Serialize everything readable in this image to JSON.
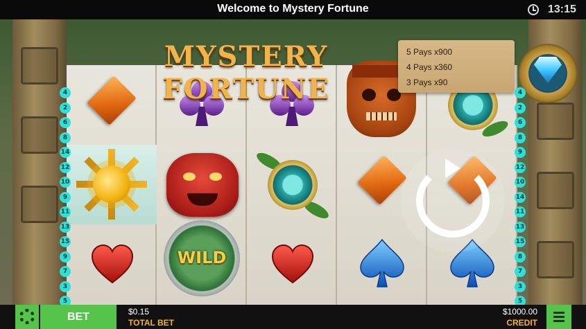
{
  "topbar": {
    "title": "Welcome to Mystery Fortune",
    "time": "13:15"
  },
  "logo": {
    "text": "MYSTERY FORTUNE"
  },
  "paytable": {
    "rows": [
      "5 Pays x900",
      "4 Pays x360",
      "3 Pays x90"
    ]
  },
  "paylines": {
    "left": [
      "4",
      "2",
      "6",
      "8",
      "14",
      "12",
      "10",
      "9",
      "11",
      "13",
      "15",
      "9",
      "7",
      "3",
      "5"
    ],
    "right": [
      "4",
      "2",
      "6",
      "8",
      "9",
      "12",
      "10",
      "14",
      "11",
      "13",
      "15",
      "8",
      "7",
      "3",
      "5"
    ]
  },
  "reels": [
    [
      "orange-diamond",
      "sun-symbol",
      "red-heart"
    ],
    [
      "purple-club",
      "red-mask",
      "wild"
    ],
    [
      "purple-club",
      "jade-medallion",
      "red-heart"
    ],
    [
      "orange-skull-mask",
      "orange-diamond",
      "blue-spade"
    ],
    [
      "jade-medallion",
      "orange-diamond",
      "blue-spade"
    ]
  ],
  "wild_label": "WILD",
  "colors": {
    "accent_green": "#56c34a",
    "label_gold": "#f5b51e",
    "payline_teal": "#2fe0d7"
  },
  "bottombar": {
    "bet_label": "BET",
    "total_bet_value": "$0.15",
    "total_bet_label": "TOTAL BET",
    "credit_value": "$1000.00",
    "credit_label": "CREDIT"
  }
}
